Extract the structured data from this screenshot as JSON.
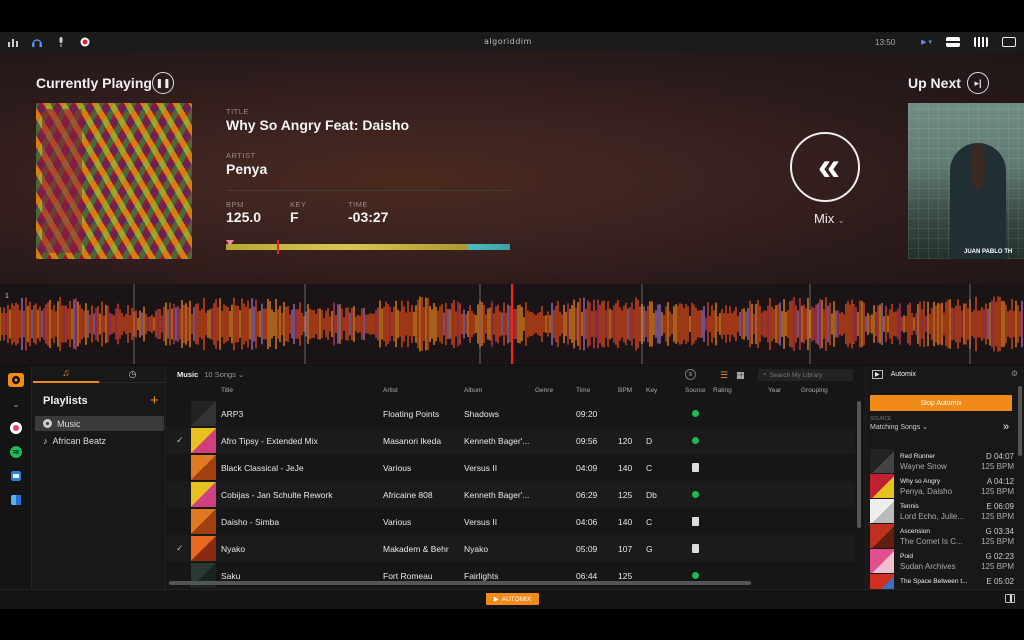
{
  "topbar": {
    "logo": "algoriddim",
    "time": "13:50"
  },
  "deck": {
    "currently_playing_label": "Currently Playing",
    "title_label": "TITLE",
    "title": "Why So Angry Feat: Daisho",
    "artist_label": "ARTIST",
    "artist": "Penya",
    "bpm_label": "BPM",
    "bpm": "125.0",
    "key_label": "KEY",
    "key": "F",
    "time_label": "TIME",
    "time": "-03:27",
    "progress": 0.18,
    "mix_label": "Mix",
    "up_next_label": "Up Next",
    "up_next_caption": "JUAN PABLO TH"
  },
  "waveform": {
    "marker": "1"
  },
  "sidebar_icons": [
    "djay-icon",
    "chevron-down-icon",
    "itunes-icon",
    "spotify-icon",
    "video-icon",
    "finder-icon"
  ],
  "playlists": {
    "heading": "Playlists",
    "items": [
      {
        "label": "Music",
        "active": true
      },
      {
        "label": "African Beatz",
        "active": false
      }
    ]
  },
  "library": {
    "source": "Music",
    "count": "10 Songs",
    "search_placeholder": "Search My Library",
    "columns": {
      "title": "Title",
      "artist": "Artist",
      "album": "Album",
      "genre": "Genre",
      "time": "Time",
      "bpm": "BPM",
      "key": "Key",
      "source": "Source",
      "rating": "Rating",
      "year": "Year",
      "grouping": "Grouping"
    },
    "rows": [
      {
        "title": "ARP3",
        "artist": "Floating Points",
        "album": "Shadows",
        "time": "09:20",
        "bpm": "",
        "key": "",
        "source": "spotify",
        "checked": false,
        "thumb": [
          "#222",
          "#333"
        ]
      },
      {
        "title": "Afro Tipsy - Extended Mix",
        "artist": "Masanori Ikeda",
        "album": "Kenneth Bager'...",
        "time": "09:56",
        "bpm": "120",
        "key": "D",
        "source": "spotify",
        "checked": true,
        "thumb": [
          "#e8c020",
          "#d04080"
        ]
      },
      {
        "title": "Black Classical - JeJe",
        "artist": "Various",
        "album": "Versus II",
        "time": "04:09",
        "bpm": "140",
        "key": "C",
        "source": "file",
        "checked": false,
        "thumb": [
          "#e07a20",
          "#a04010"
        ]
      },
      {
        "title": "Cobijas - Jan Schulte Rework",
        "artist": "Africaine 808",
        "album": "Kenneth Bager'...",
        "time": "06:29",
        "bpm": "125",
        "key": "Db",
        "source": "spotify",
        "checked": false,
        "thumb": [
          "#e8c020",
          "#d04080"
        ]
      },
      {
        "title": "Daisho - Simba",
        "artist": "Various",
        "album": "Versus II",
        "time": "04:06",
        "bpm": "140",
        "key": "C",
        "source": "file",
        "checked": false,
        "thumb": [
          "#e07a20",
          "#a04010"
        ]
      },
      {
        "title": "Nyako",
        "artist": "Makadem & Behr",
        "album": "Nyako",
        "time": "05:09",
        "bpm": "107",
        "key": "G",
        "source": "file",
        "checked": true,
        "thumb": [
          "#e86a20",
          "#8a2a10"
        ]
      },
      {
        "title": "Saku",
        "artist": "Fort Romeau",
        "album": "Fairlights",
        "time": "06:44",
        "bpm": "125",
        "key": "",
        "source": "spotify",
        "checked": false,
        "thumb": [
          "#2a3a30",
          "#1a2420"
        ]
      }
    ]
  },
  "automix": {
    "title": "Automix",
    "stop_label": "Stop Automix",
    "source_label": "SOURCE",
    "source_value": "Matching Songs",
    "queue": [
      {
        "name": "Red Runner",
        "artist": "Wayne Snow",
        "key_time": "D 04:07",
        "bpm": "125 BPM",
        "thumb": [
          "#222",
          "#444"
        ]
      },
      {
        "name": "Why so Angry",
        "artist": "Penya, Daisho",
        "key_time": "A 04:12",
        "bpm": "125 BPM",
        "thumb": [
          "#c02030",
          "#e8c020"
        ]
      },
      {
        "name": "Tennis",
        "artist": "Lord Echo, Julie...",
        "key_time": "E 06:09",
        "bpm": "125 BPM",
        "thumb": [
          "#eee",
          "#bbb"
        ]
      },
      {
        "name": "Ascension",
        "artist": "The Comet Is C...",
        "key_time": "G 03:34",
        "bpm": "125 BPM",
        "thumb": [
          "#c03020",
          "#602010"
        ]
      },
      {
        "name": "Poid",
        "artist": "Sudan Archives",
        "key_time": "G 02:23",
        "bpm": "125 BPM",
        "thumb": [
          "#e05090",
          "#f0c0d0"
        ]
      },
      {
        "name": "The Space Between t...",
        "artist": "",
        "key_time": "E 05:02",
        "bpm": "",
        "thumb": [
          "#d03020",
          "#3a70c0"
        ]
      }
    ],
    "footer_label": "AUTOMIX"
  },
  "colors": {
    "accent": "#f28a1a",
    "spotify": "#1db954"
  }
}
